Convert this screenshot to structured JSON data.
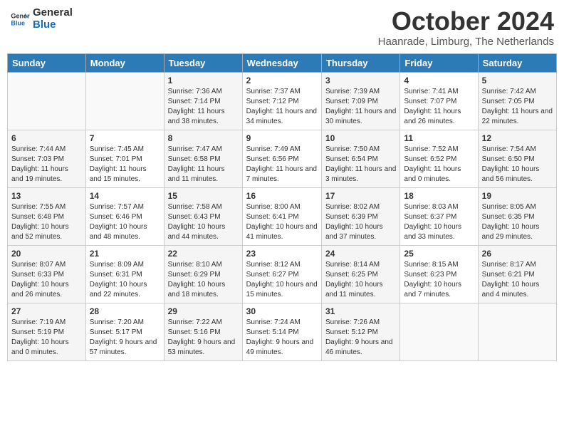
{
  "logo": {
    "line1": "General",
    "line2": "Blue"
  },
  "header": {
    "month": "October 2024",
    "location": "Haanrade, Limburg, The Netherlands"
  },
  "weekdays": [
    "Sunday",
    "Monday",
    "Tuesday",
    "Wednesday",
    "Thursday",
    "Friday",
    "Saturday"
  ],
  "weeks": [
    [
      {
        "day": "",
        "info": ""
      },
      {
        "day": "",
        "info": ""
      },
      {
        "day": "1",
        "info": "Sunrise: 7:36 AM\nSunset: 7:14 PM\nDaylight: 11 hours and 38 minutes."
      },
      {
        "day": "2",
        "info": "Sunrise: 7:37 AM\nSunset: 7:12 PM\nDaylight: 11 hours and 34 minutes."
      },
      {
        "day": "3",
        "info": "Sunrise: 7:39 AM\nSunset: 7:09 PM\nDaylight: 11 hours and 30 minutes."
      },
      {
        "day": "4",
        "info": "Sunrise: 7:41 AM\nSunset: 7:07 PM\nDaylight: 11 hours and 26 minutes."
      },
      {
        "day": "5",
        "info": "Sunrise: 7:42 AM\nSunset: 7:05 PM\nDaylight: 11 hours and 22 minutes."
      }
    ],
    [
      {
        "day": "6",
        "info": "Sunrise: 7:44 AM\nSunset: 7:03 PM\nDaylight: 11 hours and 19 minutes."
      },
      {
        "day": "7",
        "info": "Sunrise: 7:45 AM\nSunset: 7:01 PM\nDaylight: 11 hours and 15 minutes."
      },
      {
        "day": "8",
        "info": "Sunrise: 7:47 AM\nSunset: 6:58 PM\nDaylight: 11 hours and 11 minutes."
      },
      {
        "day": "9",
        "info": "Sunrise: 7:49 AM\nSunset: 6:56 PM\nDaylight: 11 hours and 7 minutes."
      },
      {
        "day": "10",
        "info": "Sunrise: 7:50 AM\nSunset: 6:54 PM\nDaylight: 11 hours and 3 minutes."
      },
      {
        "day": "11",
        "info": "Sunrise: 7:52 AM\nSunset: 6:52 PM\nDaylight: 11 hours and 0 minutes."
      },
      {
        "day": "12",
        "info": "Sunrise: 7:54 AM\nSunset: 6:50 PM\nDaylight: 10 hours and 56 minutes."
      }
    ],
    [
      {
        "day": "13",
        "info": "Sunrise: 7:55 AM\nSunset: 6:48 PM\nDaylight: 10 hours and 52 minutes."
      },
      {
        "day": "14",
        "info": "Sunrise: 7:57 AM\nSunset: 6:46 PM\nDaylight: 10 hours and 48 minutes."
      },
      {
        "day": "15",
        "info": "Sunrise: 7:58 AM\nSunset: 6:43 PM\nDaylight: 10 hours and 44 minutes."
      },
      {
        "day": "16",
        "info": "Sunrise: 8:00 AM\nSunset: 6:41 PM\nDaylight: 10 hours and 41 minutes."
      },
      {
        "day": "17",
        "info": "Sunrise: 8:02 AM\nSunset: 6:39 PM\nDaylight: 10 hours and 37 minutes."
      },
      {
        "day": "18",
        "info": "Sunrise: 8:03 AM\nSunset: 6:37 PM\nDaylight: 10 hours and 33 minutes."
      },
      {
        "day": "19",
        "info": "Sunrise: 8:05 AM\nSunset: 6:35 PM\nDaylight: 10 hours and 29 minutes."
      }
    ],
    [
      {
        "day": "20",
        "info": "Sunrise: 8:07 AM\nSunset: 6:33 PM\nDaylight: 10 hours and 26 minutes."
      },
      {
        "day": "21",
        "info": "Sunrise: 8:09 AM\nSunset: 6:31 PM\nDaylight: 10 hours and 22 minutes."
      },
      {
        "day": "22",
        "info": "Sunrise: 8:10 AM\nSunset: 6:29 PM\nDaylight: 10 hours and 18 minutes."
      },
      {
        "day": "23",
        "info": "Sunrise: 8:12 AM\nSunset: 6:27 PM\nDaylight: 10 hours and 15 minutes."
      },
      {
        "day": "24",
        "info": "Sunrise: 8:14 AM\nSunset: 6:25 PM\nDaylight: 10 hours and 11 minutes."
      },
      {
        "day": "25",
        "info": "Sunrise: 8:15 AM\nSunset: 6:23 PM\nDaylight: 10 hours and 7 minutes."
      },
      {
        "day": "26",
        "info": "Sunrise: 8:17 AM\nSunset: 6:21 PM\nDaylight: 10 hours and 4 minutes."
      }
    ],
    [
      {
        "day": "27",
        "info": "Sunrise: 7:19 AM\nSunset: 5:19 PM\nDaylight: 10 hours and 0 minutes."
      },
      {
        "day": "28",
        "info": "Sunrise: 7:20 AM\nSunset: 5:17 PM\nDaylight: 9 hours and 57 minutes."
      },
      {
        "day": "29",
        "info": "Sunrise: 7:22 AM\nSunset: 5:16 PM\nDaylight: 9 hours and 53 minutes."
      },
      {
        "day": "30",
        "info": "Sunrise: 7:24 AM\nSunset: 5:14 PM\nDaylight: 9 hours and 49 minutes."
      },
      {
        "day": "31",
        "info": "Sunrise: 7:26 AM\nSunset: 5:12 PM\nDaylight: 9 hours and 46 minutes."
      },
      {
        "day": "",
        "info": ""
      },
      {
        "day": "",
        "info": ""
      }
    ]
  ]
}
